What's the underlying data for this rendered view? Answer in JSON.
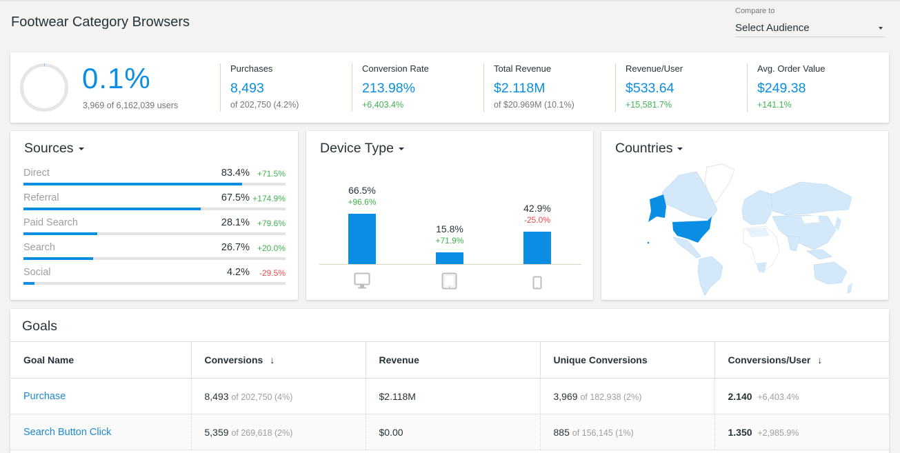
{
  "header": {
    "title": "Footwear Category Browsers",
    "compare_label": "Compare to",
    "compare_value": "Select Audience"
  },
  "summary": {
    "percent": "0.1%",
    "percent_value": 0.1,
    "subtitle": "3,969 of 6,162,039 users"
  },
  "kpis": [
    {
      "label": "Purchases",
      "value": "8,493",
      "sub": "of 202,750 (4.2%)",
      "sub_type": "muted"
    },
    {
      "label": "Conversion Rate",
      "value": "213.98%",
      "sub": "+6,403.4%",
      "sub_type": "pos"
    },
    {
      "label": "Total Revenue",
      "value": "$2.118M",
      "sub": "of $20.969M (10.1%)",
      "sub_type": "muted"
    },
    {
      "label": "Revenue/User",
      "value": "$533.64",
      "sub": "+15,581.7%",
      "sub_type": "pos"
    },
    {
      "label": "Avg. Order Value",
      "value": "$249.38",
      "sub": "+141.1%",
      "sub_type": "pos"
    }
  ],
  "sources": {
    "title": "Sources",
    "items": [
      {
        "name": "Direct",
        "pct": "83.4%",
        "value": 83.4,
        "delta": "+71.5%",
        "delta_type": "pos"
      },
      {
        "name": "Referral",
        "pct": "67.5%",
        "value": 67.5,
        "delta": "+174.9%",
        "delta_type": "pos"
      },
      {
        "name": "Paid Search",
        "pct": "28.1%",
        "value": 28.1,
        "delta": "+79.6%",
        "delta_type": "pos"
      },
      {
        "name": "Search",
        "pct": "26.7%",
        "value": 26.7,
        "delta": "+20.0%",
        "delta_type": "pos"
      },
      {
        "name": "Social",
        "pct": "4.2%",
        "value": 4.2,
        "delta": "-29.5%",
        "delta_type": "neg"
      }
    ]
  },
  "device": {
    "title": "Device Type",
    "items": [
      {
        "name": "desktop",
        "icon": "desktop-icon",
        "pct": "66.5%",
        "value": 66.5,
        "delta": "+96.6%",
        "delta_type": "pos"
      },
      {
        "name": "tablet",
        "icon": "tablet-icon",
        "pct": "15.8%",
        "value": 15.8,
        "delta": "+71.9%",
        "delta_type": "pos"
      },
      {
        "name": "mobile",
        "icon": "mobile-icon",
        "pct": "42.9%",
        "value": 42.9,
        "delta": "-25.0%",
        "delta_type": "neg"
      }
    ]
  },
  "countries": {
    "title": "Countries",
    "highlight": "United States",
    "colors": {
      "highlight": "#0a8ee3",
      "light": "#d3e8f8",
      "none": "#ffffff"
    }
  },
  "goals": {
    "title": "Goals",
    "columns": [
      {
        "label": "Goal Name",
        "sort": ""
      },
      {
        "label": "Conversions",
        "sort": "↓"
      },
      {
        "label": "Revenue",
        "sort": ""
      },
      {
        "label": "Unique Conversions",
        "sort": ""
      },
      {
        "label": "Conversions/User",
        "sort": "↓"
      }
    ],
    "rows": [
      {
        "name": "Purchase",
        "conv": "8,493",
        "conv_of": "of 202,750 (4%)",
        "revenue": "$2.118M",
        "uniq": "3,969",
        "uniq_of": "of 182,938 (2%)",
        "cpu": "2.140",
        "cpu_delta": "+6,403.4%"
      },
      {
        "name": "Search Button Click",
        "conv": "5,359",
        "conv_of": "of 269,618 (2%)",
        "revenue": "$0.00",
        "uniq": "885",
        "uniq_of": "of 156,145 (1%)",
        "cpu": "1.350",
        "cpu_delta": "+2,985.9%"
      }
    ]
  },
  "colors": {
    "accent": "#0a8ee3",
    "positive": "#3fb34f",
    "negative": "#ef4a4a"
  }
}
